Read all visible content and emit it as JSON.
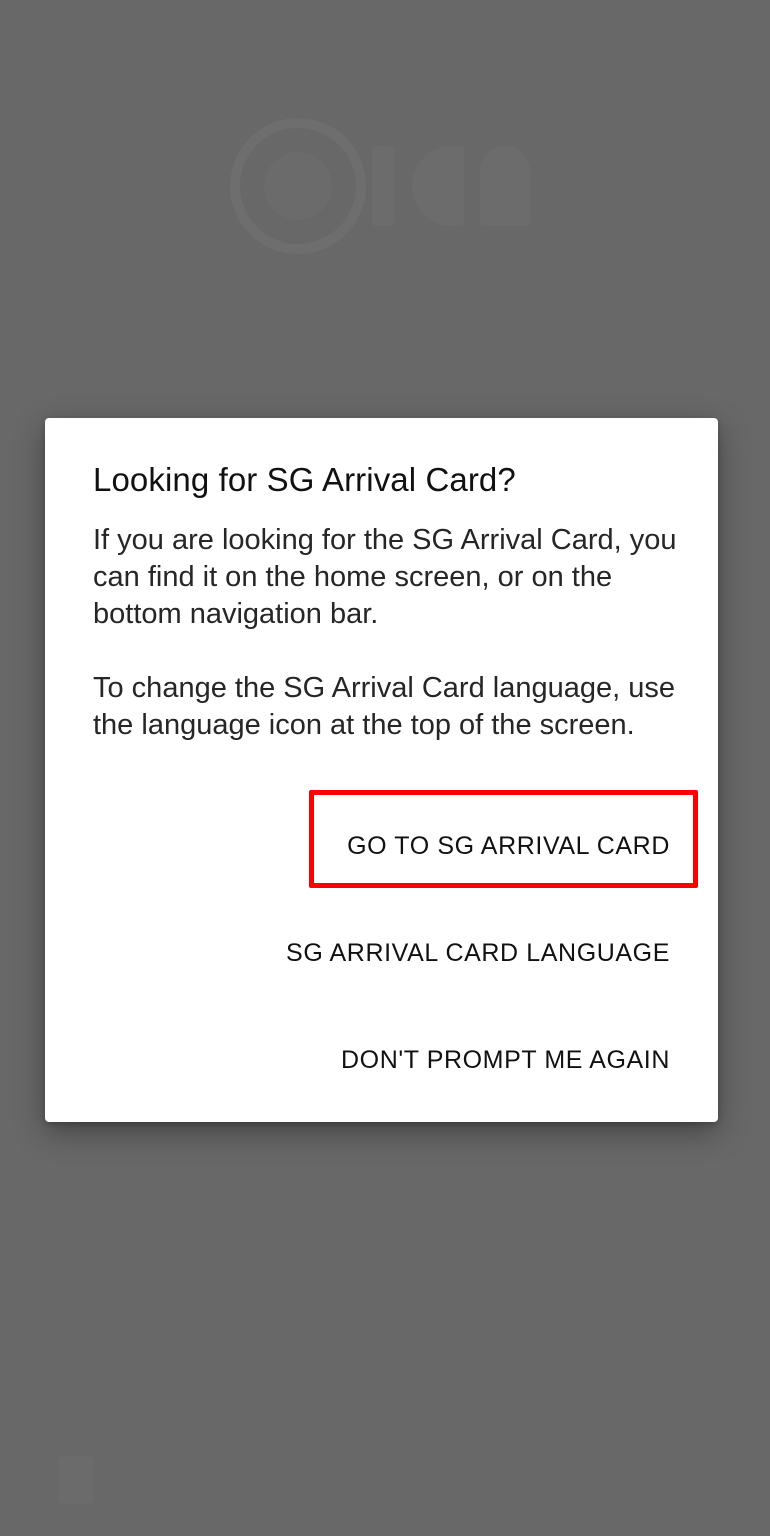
{
  "background": {
    "logo_icon": "ica-logo-icon",
    "scrim_color": "#686868"
  },
  "dialog": {
    "title": "Looking for SG Arrival Card?",
    "paragraphs": [
      "If you are looking for the SG Arrival Card, you can find it on the home screen, or on the bottom navigation bar.",
      "To change the SG Arrival Card language, use the language icon at the top of the screen."
    ],
    "actions": {
      "go_to_card": "GO TO SG ARRIVAL CARD",
      "card_language": "SG ARRIVAL CARD LANGUAGE",
      "dont_prompt": "DON'T PROMPT ME AGAIN"
    },
    "highlight_color": "#ff0000"
  }
}
